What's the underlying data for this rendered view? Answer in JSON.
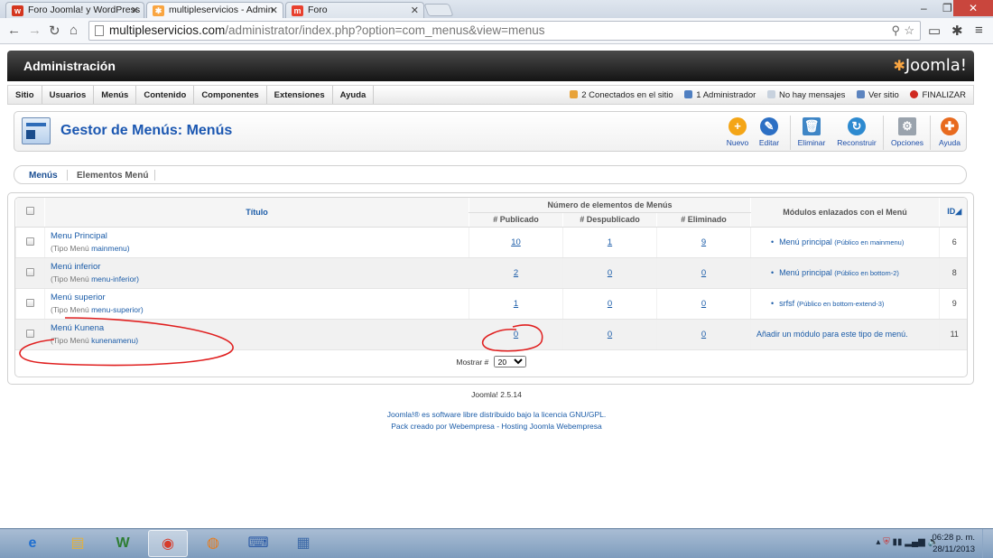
{
  "browser": {
    "tabs": [
      {
        "label": "Foro Joomla! y WordPress",
        "favicon": "w",
        "color": "#d4361f"
      },
      {
        "label": "multipleservicios - Admin",
        "favicon": "joomla",
        "color": "#f9a541"
      },
      {
        "label": "Foro",
        "favicon": "m",
        "color": "#e8402e"
      }
    ],
    "url_host": "multipleservicios.com",
    "url_path": "/administrator/index.php?option=com_menus&view=menus"
  },
  "admin": {
    "header_title": "Administración",
    "logo_text": "Joomla!",
    "menu": [
      "Sitio",
      "Usuarios",
      "Menús",
      "Contenido",
      "Componentes",
      "Extensiones",
      "Ayuda"
    ],
    "status": {
      "online": "2 Conectados en el sitio",
      "admins": "1 Administrador",
      "messages": "No hay mensajes",
      "view_site": "Ver sitio",
      "logout": "FINALIZAR"
    },
    "page_title": "Gestor de Menús: Menús",
    "toolbar": {
      "new": "Nuevo",
      "edit": "Editar",
      "delete": "Eliminar",
      "rebuild": "Reconstruir",
      "options": "Opciones",
      "help": "Ayuda"
    },
    "submenu": {
      "menus": "Menús",
      "items": "Elementos Menú"
    }
  },
  "table": {
    "col_title": "Título",
    "group_header": "Número de elementos de Menús",
    "col_published": "# Publicado",
    "col_unpublished": "# Despublicado",
    "col_trashed": "# Eliminado",
    "col_modules": "Módulos enlazados con el Menú",
    "col_id": "ID",
    "rows": [
      {
        "name": "Menu Principal",
        "type_prefix": "(Tipo Menú",
        "type": "mainmenu)",
        "published": "10",
        "unpublished": "1",
        "trashed": "9",
        "module": "Menú principal",
        "module_note": "(Público en mainmenu)",
        "id": "6"
      },
      {
        "name": "Menú inferior",
        "type_prefix": "(Tipo Menú",
        "type": "menu-inferior)",
        "published": "2",
        "unpublished": "0",
        "trashed": "0",
        "module": "Menú principal",
        "module_note": "(Público en bottom-2)",
        "id": "8"
      },
      {
        "name": "Menú superior",
        "type_prefix": "(Tipo Menú",
        "type": "menu-superior)",
        "published": "1",
        "unpublished": "0",
        "trashed": "0",
        "module": "srfsf",
        "module_note": "(Público en bottom-extend-3)",
        "id": "9"
      },
      {
        "name": "Menú Kunena",
        "type_prefix": "(Tipo Menú",
        "type": "kunenamenu)",
        "published": "0",
        "unpublished": "0",
        "trashed": "0",
        "add_module": "Añadir un módulo para este tipo de menú.",
        "id": "11"
      }
    ],
    "show_label": "Mostrar #",
    "show_value": "20"
  },
  "footer": {
    "version": "Joomla! 2.5.14",
    "license": "Joomla!® es software libre distribuido bajo la licencia GNU/GPL.",
    "credits": "Pack creado por Webempresa - Hosting Joomla Webempresa"
  },
  "taskbar": {
    "time": "06:28 p. m.",
    "date": "28/11/2013"
  }
}
